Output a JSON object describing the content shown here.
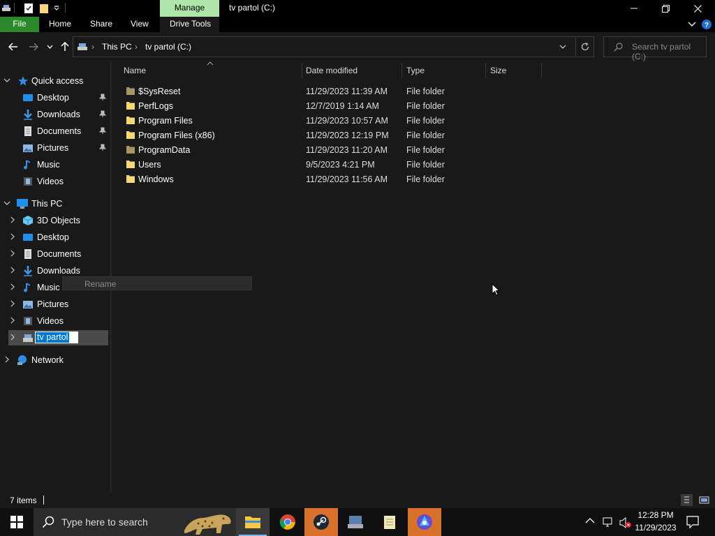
{
  "window": {
    "title": "tv partol (C:)",
    "manage_tab": "Manage"
  },
  "ribbon": {
    "tabs": [
      "File",
      "Home",
      "Share",
      "View",
      "Drive Tools"
    ]
  },
  "address": {
    "crumbs": [
      "This PC",
      "tv partol (C:)"
    ],
    "search_placeholder": "Search tv partol (C:)"
  },
  "navpane": {
    "quick_access": "Quick access",
    "quick_items": [
      "Desktop",
      "Downloads",
      "Documents",
      "Pictures",
      "Music",
      "Videos"
    ],
    "this_pc": "This PC",
    "pc_items": [
      "3D Objects",
      "Desktop",
      "Documents",
      "Downloads",
      "Music",
      "Pictures",
      "Videos"
    ],
    "rename_value": "tv partol",
    "network": "Network"
  },
  "columns": {
    "name": "Name",
    "date": "Date modified",
    "type": "Type",
    "size": "Size"
  },
  "files": [
    {
      "name": "$SysReset",
      "date": "11/29/2023 11:39 AM",
      "type": "File folder"
    },
    {
      "name": "PerfLogs",
      "date": "12/7/2019 1:14 AM",
      "type": "File folder"
    },
    {
      "name": "Program Files",
      "date": "11/29/2023 10:57 AM",
      "type": "File folder"
    },
    {
      "name": "Program Files (x86)",
      "date": "11/29/2023 12:19 PM",
      "type": "File folder"
    },
    {
      "name": "ProgramData",
      "date": "11/29/2023 11:20 AM",
      "type": "File folder"
    },
    {
      "name": "Users",
      "date": "9/5/2023 4:21 PM",
      "type": "File folder"
    },
    {
      "name": "Windows",
      "date": "11/29/2023 11:56 AM",
      "type": "File folder"
    }
  ],
  "tooltip": "Rename",
  "status": {
    "items": "7 items"
  },
  "taskbar": {
    "search_placeholder": "Type here to search",
    "time": "12:28 PM",
    "date": "11/29/2023"
  },
  "colors": {
    "accent_green": "#2a8a2a",
    "manage_tab": "#ade6a8",
    "selection_blue": "#0078d7",
    "folder_yellow": "#f8d775"
  }
}
